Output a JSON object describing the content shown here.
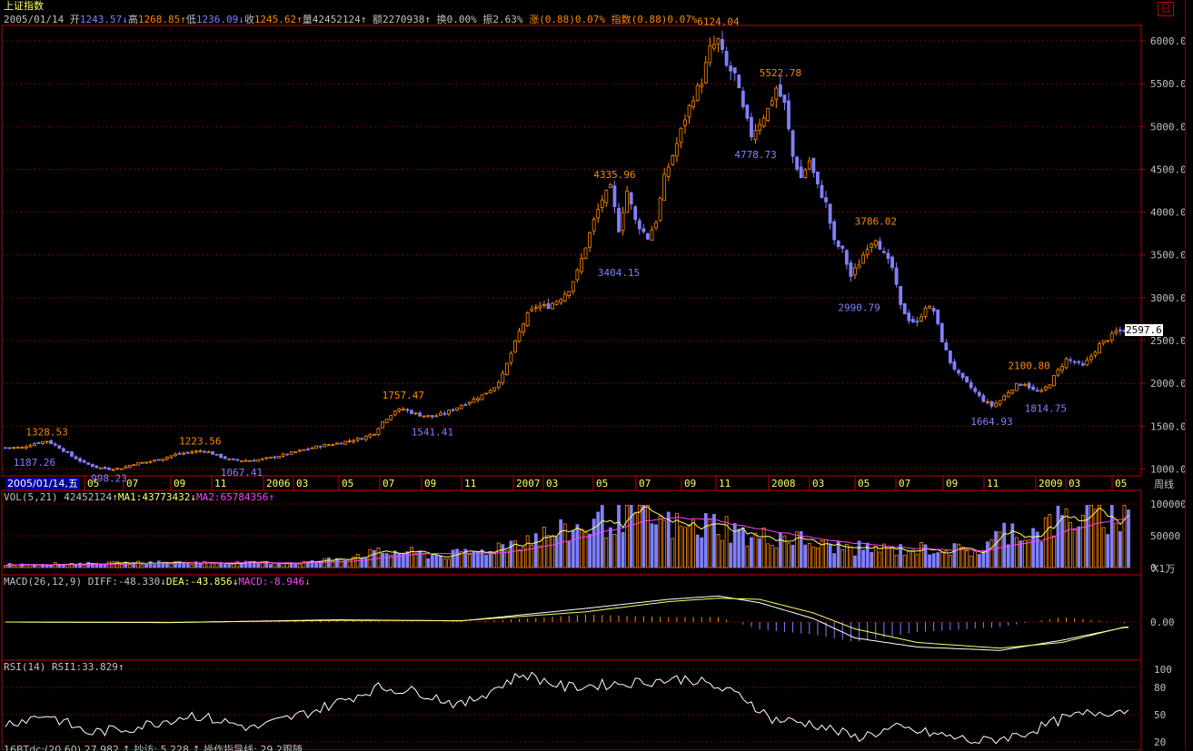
{
  "header": {
    "title": "上证指数",
    "date": "2005/01/14",
    "open_label": "开",
    "open": "1243.57",
    "high_label": "高",
    "high": "1268.85",
    "low_label": "低",
    "low": "1236.09",
    "close_label": "收",
    "close": "1245.62",
    "volume_label": "量",
    "volume": "42452124",
    "amount_label": "额",
    "amount": "2270938",
    "turnover": "换0.00%",
    "amplitude": "振2.63%",
    "change": "涨(0.88)0.07%",
    "index_change": "指数(0.88)0.07%",
    "corner_glyph": "日"
  },
  "cursor_date": "2005/01/14,五",
  "period_label": "周线",
  "volume_unit": "X1万",
  "last_price_tag": "2597.6",
  "vol_header": {
    "name": "VOL(5,21)",
    "value": "42452124",
    "ma1": "MA1:43773432",
    "ma2": "MA2:65784356"
  },
  "macd_header": {
    "name": "MACD(26,12,9)",
    "diff": "DIFF:-48.330",
    "dea": "DEA:-43.856",
    "macd": "MACD:-8.946"
  },
  "rsi_header": {
    "name": "RSI(14)",
    "rsi1": "RSI1:33.829"
  },
  "bottom_header": {
    "text": "16BTdc:(20,60)  27.982 ↑ 抄访: 5.228 ↑ 操作指导线: 29 2跟随"
  },
  "colors": {
    "up": "#ff8800",
    "down": "#8080ff",
    "grid": "#800000",
    "axis": "#c00000",
    "ma1": "#ffff66",
    "ma2": "#ff40ff",
    "line": "#ffffff"
  },
  "chart_data": [
    {
      "type": "candlestick",
      "title": "上证指数",
      "period": "weekly",
      "x_ticks": [
        "05",
        "07",
        "09",
        "11",
        "2006",
        "03",
        "05",
        "07",
        "09",
        "11",
        "2007",
        "03",
        "05",
        "07",
        "09",
        "11",
        "2008",
        "03",
        "05",
        "07",
        "09",
        "11",
        "2009",
        "03",
        "05"
      ],
      "y_ticks": [
        "1000.0",
        "1500.0",
        "2000.0",
        "2500.0",
        "3000.0",
        "3500.0",
        "4000.0",
        "4500.0",
        "5000.0",
        "5500.0",
        "6000.0"
      ],
      "ylim": [
        920,
        6180
      ],
      "price_path": [
        [
          0,
          1250
        ],
        [
          4,
          1250
        ],
        [
          7,
          1300
        ],
        [
          10,
          1328
        ],
        [
          13,
          1250
        ],
        [
          16,
          1150
        ],
        [
          19,
          1070
        ],
        [
          22,
          1020
        ],
        [
          25,
          1000
        ],
        [
          28,
          1010
        ],
        [
          31,
          1060
        ],
        [
          34,
          1080
        ],
        [
          37,
          1110
        ],
        [
          41,
          1170
        ],
        [
          45,
          1200
        ],
        [
          48,
          1215
        ],
        [
          51,
          1160
        ],
        [
          54,
          1110
        ],
        [
          57,
          1100
        ],
        [
          60,
          1100
        ],
        [
          65,
          1140
        ],
        [
          70,
          1200
        ],
        [
          75,
          1260
        ],
        [
          80,
          1300
        ],
        [
          83,
          1330
        ],
        [
          86,
          1360
        ],
        [
          89,
          1420
        ],
        [
          91,
          1550
        ],
        [
          94,
          1680
        ],
        [
          96,
          1700
        ],
        [
          98,
          1660
        ],
        [
          100,
          1630
        ],
        [
          103,
          1610
        ],
        [
          106,
          1650
        ],
        [
          109,
          1720
        ],
        [
          112,
          1790
        ],
        [
          115,
          1860
        ],
        [
          118,
          1960
        ],
        [
          120,
          2100
        ],
        [
          122,
          2350
        ],
        [
          124,
          2600
        ],
        [
          126,
          2800
        ],
        [
          128,
          2900
        ],
        [
          131,
          2900
        ],
        [
          134,
          3000
        ],
        [
          136,
          3100
        ],
        [
          138,
          3300
        ],
        [
          140,
          3600
        ],
        [
          142,
          3900
        ],
        [
          144,
          4150
        ],
        [
          146,
          4280
        ],
        [
          148,
          3800
        ],
        [
          150,
          4250
        ],
        [
          152,
          3900
        ],
        [
          155,
          3700
        ],
        [
          157,
          3900
        ],
        [
          159,
          4400
        ],
        [
          162,
          4800
        ],
        [
          164,
          5100
        ],
        [
          166,
          5350
        ],
        [
          168,
          5530
        ],
        [
          170,
          5900
        ],
        [
          172,
          6000
        ],
        [
          174,
          5700
        ],
        [
          176,
          5600
        ],
        [
          178,
          5200
        ],
        [
          180,
          4900
        ],
        [
          182,
          5050
        ],
        [
          184,
          5200
        ],
        [
          186,
          5450
        ],
        [
          188,
          5260
        ],
        [
          190,
          4650
        ],
        [
          192,
          4400
        ],
        [
          194,
          4600
        ],
        [
          196,
          4300
        ],
        [
          198,
          4100
        ],
        [
          200,
          3650
        ],
        [
          202,
          3550
        ],
        [
          204,
          3250
        ],
        [
          206,
          3400
        ],
        [
          208,
          3600
        ],
        [
          210,
          3700
        ],
        [
          212,
          3500
        ],
        [
          214,
          3350
        ],
        [
          216,
          2900
        ],
        [
          218,
          2750
        ],
        [
          220,
          2700
        ],
        [
          222,
          2900
        ],
        [
          224,
          2850
        ],
        [
          226,
          2500
        ],
        [
          228,
          2250
        ],
        [
          230,
          2100
        ],
        [
          232,
          2000
        ],
        [
          234,
          1900
        ],
        [
          236,
          1800
        ],
        [
          238,
          1740
        ],
        [
          240,
          1800
        ],
        [
          242,
          1900
        ],
        [
          244,
          1980
        ],
        [
          246,
          2000
        ],
        [
          248,
          1920
        ],
        [
          250,
          1900
        ],
        [
          252,
          2000
        ],
        [
          254,
          2150
        ],
        [
          256,
          2280
        ],
        [
          258,
          2250
        ],
        [
          260,
          2200
        ],
        [
          262,
          2320
        ],
        [
          264,
          2450
        ],
        [
          266,
          2520
        ],
        [
          268,
          2600
        ],
        [
          270,
          2620
        ]
      ],
      "annotations": [
        {
          "label": "1328.53",
          "x": 10,
          "kind": "high"
        },
        {
          "label": "1187.26",
          "x": 7,
          "kind": "low"
        },
        {
          "label": "998.23",
          "x": 25,
          "kind": "low"
        },
        {
          "label": "1223.56",
          "x": 47,
          "kind": "high"
        },
        {
          "label": "1067.41",
          "x": 57,
          "kind": "low"
        },
        {
          "label": "1757.47",
          "x": 96,
          "kind": "high"
        },
        {
          "label": "1541.41",
          "x": 103,
          "kind": "low"
        },
        {
          "label": "4335.96",
          "x": 147,
          "kind": "high"
        },
        {
          "label": "3404.15",
          "x": 148,
          "kind": "low"
        },
        {
          "label": "6124.04",
          "x": 172,
          "kind": "high"
        },
        {
          "label": "4778.73",
          "x": 181,
          "kind": "low"
        },
        {
          "label": "5522.78",
          "x": 187,
          "kind": "high"
        },
        {
          "label": "3786.02",
          "x": 210,
          "kind": "high"
        },
        {
          "label": "2990.79",
          "x": 206,
          "kind": "low"
        },
        {
          "label": "1664.93",
          "x": 238,
          "kind": "low"
        },
        {
          "label": "2100.80",
          "x": 247,
          "kind": "high"
        },
        {
          "label": "1814.75",
          "x": 251,
          "kind": "low"
        }
      ]
    },
    {
      "type": "bar",
      "title": "VOL(5,21)",
      "y_ticks": [
        "100000",
        "50000",
        "0"
      ],
      "ylim": [
        0,
        100000
      ],
      "volume_path": [
        [
          0,
          5000
        ],
        [
          20,
          6000
        ],
        [
          40,
          8000
        ],
        [
          60,
          7000
        ],
        [
          75,
          9000
        ],
        [
          85,
          20000
        ],
        [
          95,
          25000
        ],
        [
          105,
          18000
        ],
        [
          115,
          25000
        ],
        [
          125,
          45000
        ],
        [
          135,
          55000
        ],
        [
          145,
          75000
        ],
        [
          150,
          90000
        ],
        [
          158,
          70000
        ],
        [
          165,
          60000
        ],
        [
          172,
          70000
        ],
        [
          180,
          45000
        ],
        [
          188,
          50000
        ],
        [
          196,
          35000
        ],
        [
          205,
          30000
        ],
        [
          215,
          28000
        ],
        [
          225,
          30000
        ],
        [
          235,
          25000
        ],
        [
          242,
          60000
        ],
        [
          248,
          55000
        ],
        [
          255,
          75000
        ],
        [
          262,
          85000
        ],
        [
          270,
          80000
        ]
      ]
    },
    {
      "type": "line",
      "title": "MACD(26,12,9)",
      "y_ticks": [
        "0.00"
      ],
      "diff_path": [
        [
          0,
          0
        ],
        [
          40,
          -5
        ],
        [
          80,
          20
        ],
        [
          110,
          10
        ],
        [
          140,
          120
        ],
        [
          160,
          200
        ],
        [
          172,
          230
        ],
        [
          182,
          170
        ],
        [
          195,
          30
        ],
        [
          205,
          -140
        ],
        [
          220,
          -220
        ],
        [
          240,
          -250
        ],
        [
          255,
          -160
        ],
        [
          270,
          -48
        ]
      ],
      "dea_path": [
        [
          0,
          0
        ],
        [
          40,
          -3
        ],
        [
          80,
          15
        ],
        [
          110,
          12
        ],
        [
          140,
          90
        ],
        [
          160,
          180
        ],
        [
          172,
          210
        ],
        [
          182,
          200
        ],
        [
          195,
          80
        ],
        [
          205,
          -60
        ],
        [
          220,
          -180
        ],
        [
          240,
          -230
        ],
        [
          255,
          -180
        ],
        [
          270,
          -44
        ]
      ],
      "ylim": [
        -320,
        320
      ]
    },
    {
      "type": "line",
      "title": "RSI(14)",
      "y_ticks": [
        "100",
        "80",
        "50",
        "20"
      ],
      "ylim": [
        15,
        100
      ],
      "rsi_path": [
        [
          0,
          40
        ],
        [
          10,
          50
        ],
        [
          20,
          30
        ],
        [
          30,
          35
        ],
        [
          45,
          50
        ],
        [
          60,
          35
        ],
        [
          75,
          55
        ],
        [
          90,
          80
        ],
        [
          100,
          75
        ],
        [
          110,
          60
        ],
        [
          125,
          95
        ],
        [
          135,
          80
        ],
        [
          150,
          85
        ],
        [
          165,
          90
        ],
        [
          178,
          70
        ],
        [
          185,
          45
        ],
        [
          195,
          40
        ],
        [
          205,
          25
        ],
        [
          215,
          35
        ],
        [
          225,
          28
        ],
        [
          235,
          20
        ],
        [
          245,
          28
        ],
        [
          255,
          45
        ],
        [
          262,
          52
        ],
        [
          270,
          55
        ]
      ]
    }
  ]
}
